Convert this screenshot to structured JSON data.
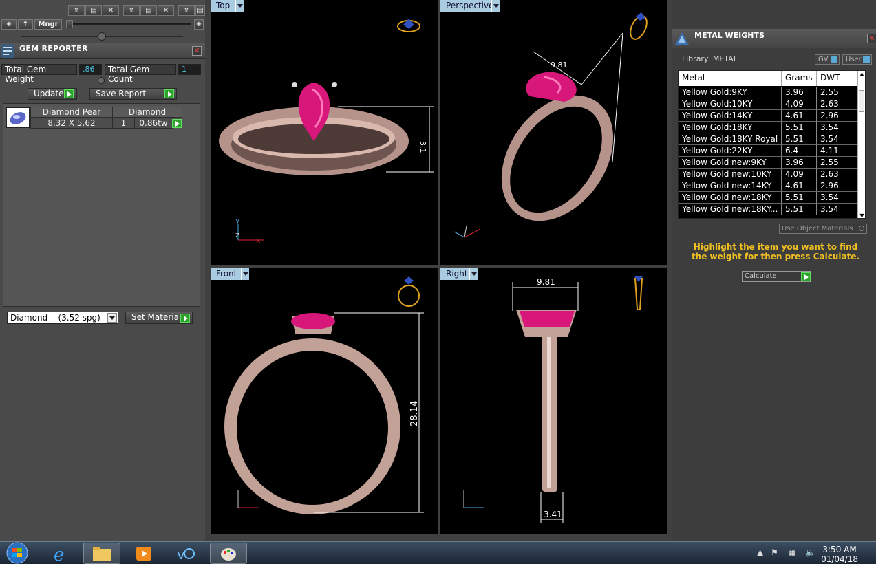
{
  "toolbar": {
    "mngr_label": "Mngr",
    "plus": "+",
    "up": "↑"
  },
  "gem_reporter": {
    "title": "GEM REPORTER",
    "total_weight_label": "Total Gem Weight",
    "total_weight_value": ".86",
    "total_count_label": "Total Gem Count",
    "total_count_value": "1",
    "update_label": "Update",
    "save_report_label": "Save Report",
    "columns": [
      "Diamond Pear",
      "Diamond"
    ],
    "row": {
      "size": "8.32 X 5.62",
      "count": "1",
      "weight": "0.86tw"
    },
    "material_select": "Diamond    (3.52 spg)",
    "set_material_label": "Set Material"
  },
  "viewports": {
    "top": {
      "label": "Top",
      "dim": "3.1"
    },
    "perspective": {
      "label": "Perspective",
      "dim_a": "9.81"
    },
    "front": {
      "label": "Front",
      "dim": "28.14"
    },
    "right": {
      "label": "Right",
      "dim_top": "9.81",
      "dim_bottom": "3.41"
    },
    "axes": {
      "x": "x",
      "y": "y",
      "z": "z"
    }
  },
  "metal_weights": {
    "title": "METAL WEIGHTS",
    "library_label": "Library: METAL",
    "gv_label": "GV",
    "user_label": "User",
    "columns": [
      "Metal",
      "Grams",
      "DWT"
    ],
    "rows": [
      [
        "Yellow Gold:9KY",
        "3.96",
        "2.55"
      ],
      [
        "Yellow Gold:10KY",
        "4.09",
        "2.63"
      ],
      [
        "Yellow Gold:14KY",
        "4.61",
        "2.96"
      ],
      [
        "Yellow Gold:18KY",
        "5.51",
        "3.54"
      ],
      [
        "Yellow Gold:18KY Royal",
        "5.51",
        "3.54"
      ],
      [
        "Yellow Gold:22KY",
        "6.4",
        "4.11"
      ],
      [
        "Yellow Gold new:9KY",
        "3.96",
        "2.55"
      ],
      [
        "Yellow Gold new:10KY",
        "4.09",
        "2.63"
      ],
      [
        "Yellow Gold new:14KY",
        "4.61",
        "2.96"
      ],
      [
        "Yellow Gold new:18KY",
        "5.51",
        "3.54"
      ],
      [
        "Yellow Gold new:18KY...",
        "5.51",
        "3.54"
      ]
    ],
    "use_object_label": "Use Object Materials",
    "hint": "Highlight the item you want to find the weight for then press Calculate.",
    "calculate_label": "Calculate"
  },
  "taskbar": {
    "time": "3:50 AM",
    "date": "01/04/18"
  },
  "colors": {
    "gem": "#d8177a",
    "metal": "#c9a59a",
    "accent": "#a9cce0",
    "hint": "#f0c020"
  }
}
